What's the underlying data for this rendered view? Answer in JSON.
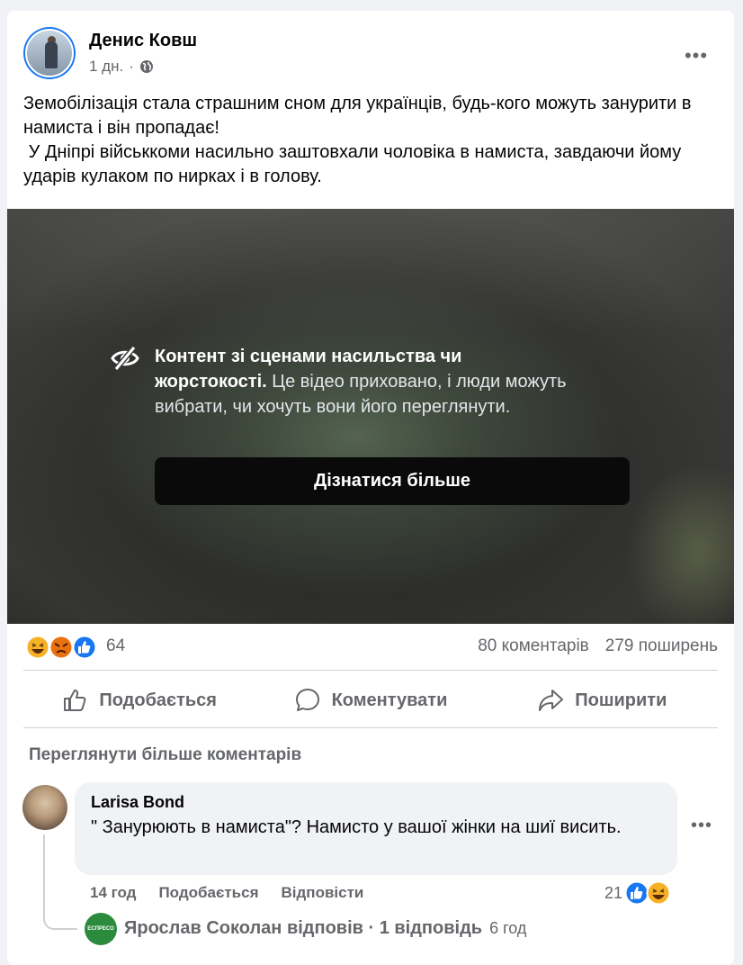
{
  "post": {
    "author": "Денис Ковш",
    "time": "1 дн.",
    "privacy_icon": "globe-icon",
    "text": "Земобілізація стала страшним сном для українців, будь-кого можуть занурити в намиста і він пропадає!\n У Дніпрі військкоми насильно заштовхали чоловіка в намиста, завдаючи йому ударів кулаком по нирках і в голову."
  },
  "warning": {
    "title": "Контент зі сценами насильства чи жорстокості.",
    "body": " Це відео приховано, і люди можуть вибрати, чи хочуть вони його переглянути.",
    "button": "Дізнатися більше",
    "icon": "eye-slash-icon"
  },
  "stats": {
    "reactions": "64",
    "comments": "80 коментарів",
    "shares": "279 поширень"
  },
  "actions": {
    "like": "Подобається",
    "comment": "Коментувати",
    "share": "Поширити"
  },
  "comments": {
    "more": "Переглянути більше коментарів",
    "items": [
      {
        "author": "Larisa Bond",
        "text": "\" Занурюють в намиста\"? Намисто у вашої жінки на шиї висить.",
        "time": "14 год",
        "like": "Подобається",
        "reply": "Відповісти",
        "reactions": "21"
      }
    ],
    "reply_summary": {
      "avatar_text": "ЕСПРЕСО",
      "text": "Ярослав Соколан відповів · 1 відповідь",
      "time": "6 год"
    }
  },
  "colors": {
    "accent": "#1877f2",
    "secondary_text": "#65676b",
    "angry": "#e9710f",
    "haha": "#f7b125"
  }
}
